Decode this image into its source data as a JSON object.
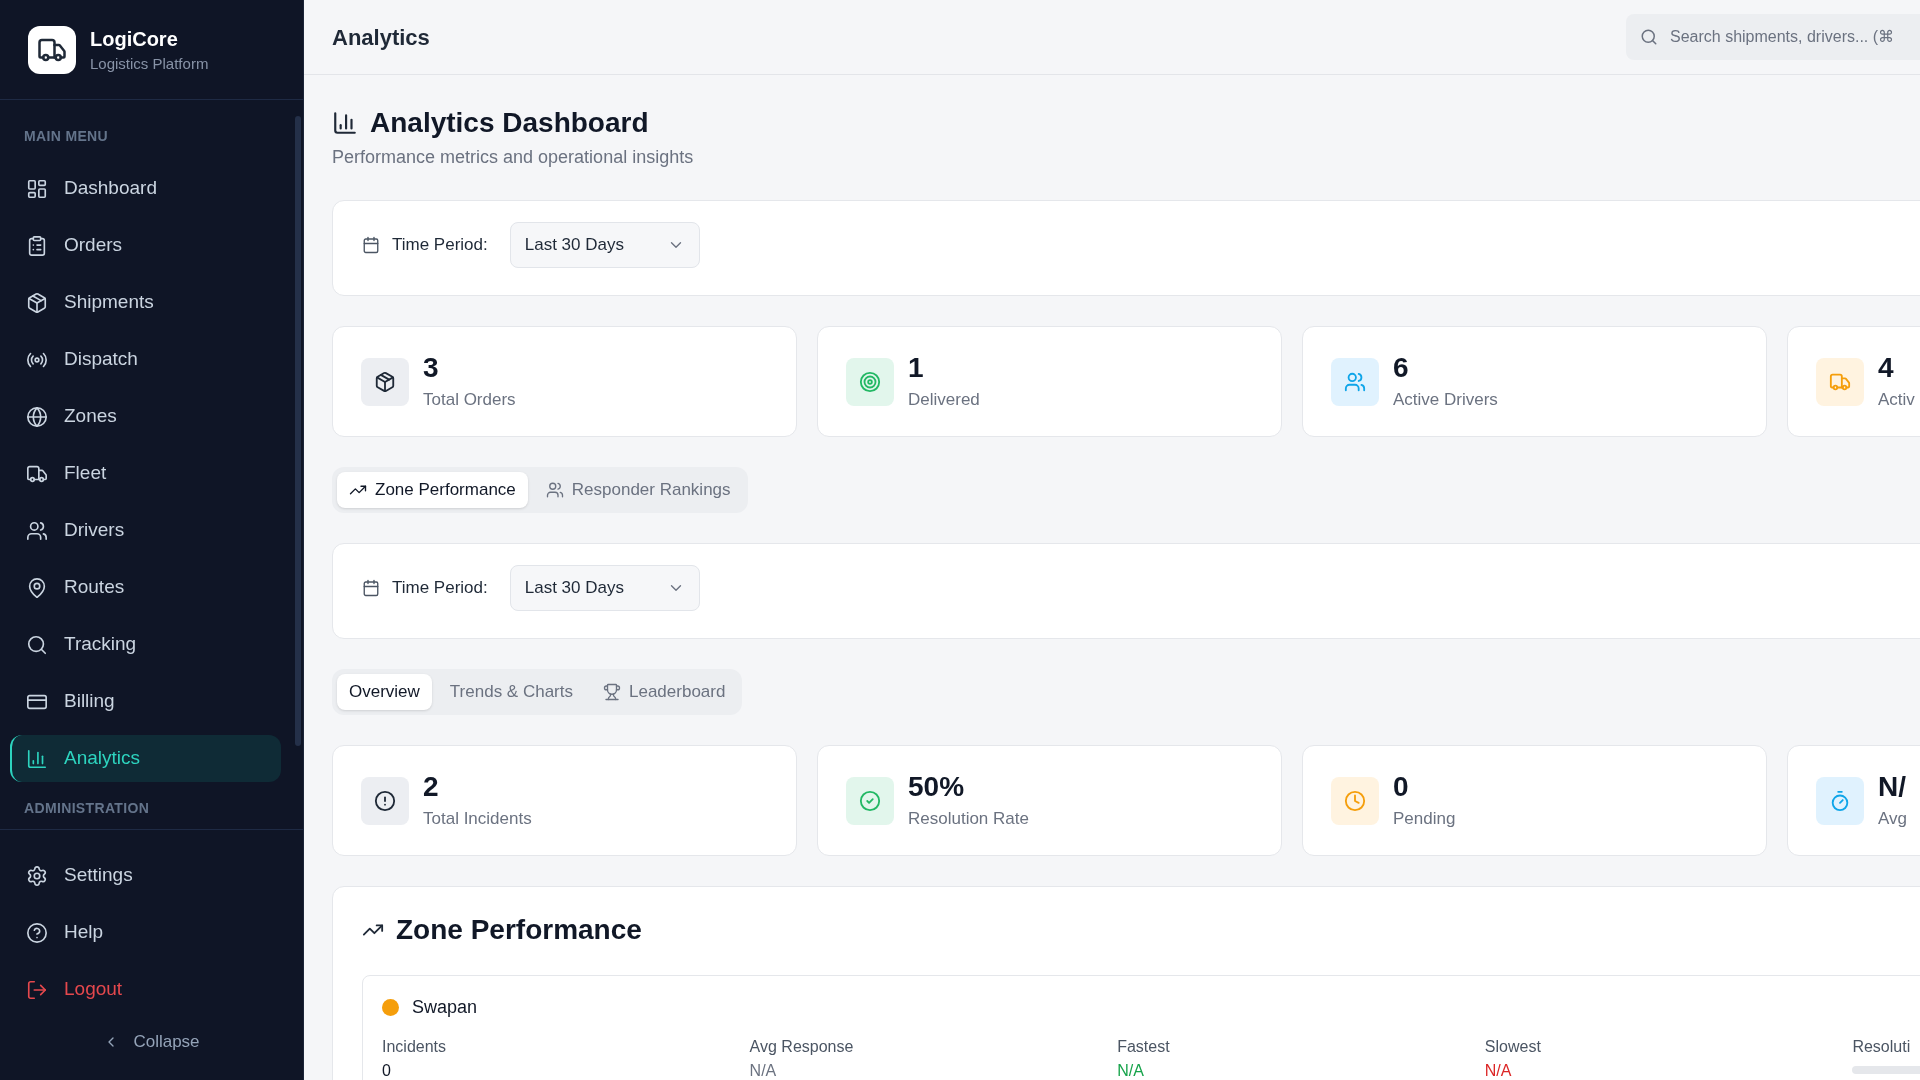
{
  "sidebar": {
    "brand": {
      "name": "LogiCore",
      "tagline": "Logistics Platform"
    },
    "main_menu": {
      "heading": "MAIN MENU",
      "items": [
        {
          "label": "Dashboard",
          "selected": false
        },
        {
          "label": "Orders",
          "selected": false
        },
        {
          "label": "Shipments",
          "selected": false
        },
        {
          "label": "Dispatch",
          "selected": false
        },
        {
          "label": "Zones",
          "selected": false
        },
        {
          "label": "Fleet",
          "selected": false
        },
        {
          "label": "Drivers",
          "selected": false
        },
        {
          "label": "Routes",
          "selected": false
        },
        {
          "label": "Tracking",
          "selected": false
        },
        {
          "label": "Billing",
          "selected": false
        },
        {
          "label": "Analytics",
          "selected": true
        }
      ]
    },
    "administration": {
      "heading": "ADMINISTRATION"
    },
    "footer_items": [
      {
        "label": "Settings",
        "kind": "normal",
        "selected": false
      },
      {
        "label": "Help",
        "kind": "normal",
        "selected": false
      },
      {
        "label": "Logout",
        "kind": "danger",
        "selected": false
      }
    ],
    "collapse": "Collapse"
  },
  "header": {
    "title": "Analytics",
    "search": {
      "placeholder": "Search shipments, drivers... (⌘"
    }
  },
  "page": {
    "title": "Analytics Dashboard",
    "subtitle": "Performance metrics and operational insights"
  },
  "overview_filter": {
    "label": "Time Period:",
    "value": "Last 30 Days"
  },
  "overview_stats": [
    {
      "value": "3",
      "label": "Total Orders",
      "kind": "neutral"
    },
    {
      "value": "1",
      "label": "Delivered",
      "kind": "success"
    },
    {
      "value": "6",
      "label": "Active Drivers",
      "kind": "info"
    },
    {
      "value": "4",
      "label": "Activ",
      "kind": "warning"
    }
  ],
  "section_tabs": [
    {
      "label": "Zone Performance",
      "selected": true
    },
    {
      "label": "Responder Rankings",
      "selected": false
    }
  ],
  "incident_filter": {
    "label": "Time Period:",
    "value": "Last 30 Days"
  },
  "incident_tabs": [
    {
      "label": "Overview",
      "selected": true
    },
    {
      "label": "Trends & Charts",
      "selected": false
    },
    {
      "label": "Leaderboard",
      "selected": false
    }
  ],
  "incident_stats": [
    {
      "value": "2",
      "label": "Total Incidents",
      "kind": "neutral"
    },
    {
      "value": "50%",
      "label": "Resolution Rate",
      "kind": "success"
    },
    {
      "value": "0",
      "label": "Pending",
      "kind": "warning"
    },
    {
      "value": "N/",
      "label": "Avg",
      "kind": "info"
    }
  ],
  "zone_performance": {
    "title": "Zone Performance",
    "zones": [
      {
        "name": "Swapan",
        "color": "#f59e0b",
        "metrics": [
          {
            "label": "Incidents",
            "value": "0",
            "kind": "plain"
          },
          {
            "label": "Avg Response",
            "value": "N/A",
            "kind": "muted"
          },
          {
            "label": "Fastest",
            "value": "N/A",
            "kind": "good"
          },
          {
            "label": "Slowest",
            "value": "N/A",
            "kind": "bad"
          },
          {
            "label": "Resoluti",
            "kind": "meter"
          }
        ]
      }
    ]
  }
}
